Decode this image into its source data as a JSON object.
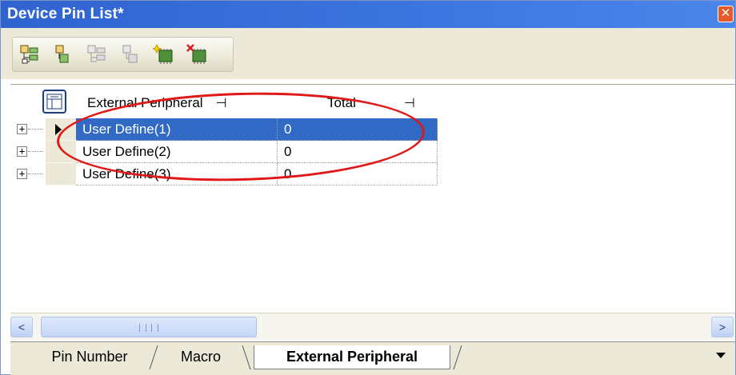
{
  "window": {
    "title": "Device Pin List*",
    "close_icon": "close-icon"
  },
  "toolbar": {
    "buttons": [
      {
        "name": "expand-all-icon"
      },
      {
        "name": "collapse-all-icon"
      },
      {
        "name": "expand-disabled-icon"
      },
      {
        "name": "collapse-disabled-icon"
      },
      {
        "name": "add-peripheral-icon"
      },
      {
        "name": "delete-peripheral-icon"
      }
    ]
  },
  "table": {
    "columns": [
      {
        "label": "External Peripheral",
        "pin_glyph": "⊣"
      },
      {
        "label": "Total",
        "pin_glyph": "⊣"
      }
    ],
    "rows": [
      {
        "name": "User Define(1)",
        "total": "0",
        "selected": true
      },
      {
        "name": "User Define(2)",
        "total": "0",
        "selected": false
      },
      {
        "name": "User Define(3)",
        "total": "0",
        "selected": false
      }
    ],
    "expander_glyph": "+"
  },
  "scrollbar": {
    "left_arrow": "<",
    "right_arrow": ">"
  },
  "tabs": [
    {
      "label": "Pin Number",
      "active": false
    },
    {
      "label": "Macro",
      "active": false
    },
    {
      "label": "External Peripheral",
      "active": true
    }
  ],
  "colors": {
    "selection": "#316ac5",
    "annotation": "#e01818",
    "title_bar": "#3d76e0"
  }
}
